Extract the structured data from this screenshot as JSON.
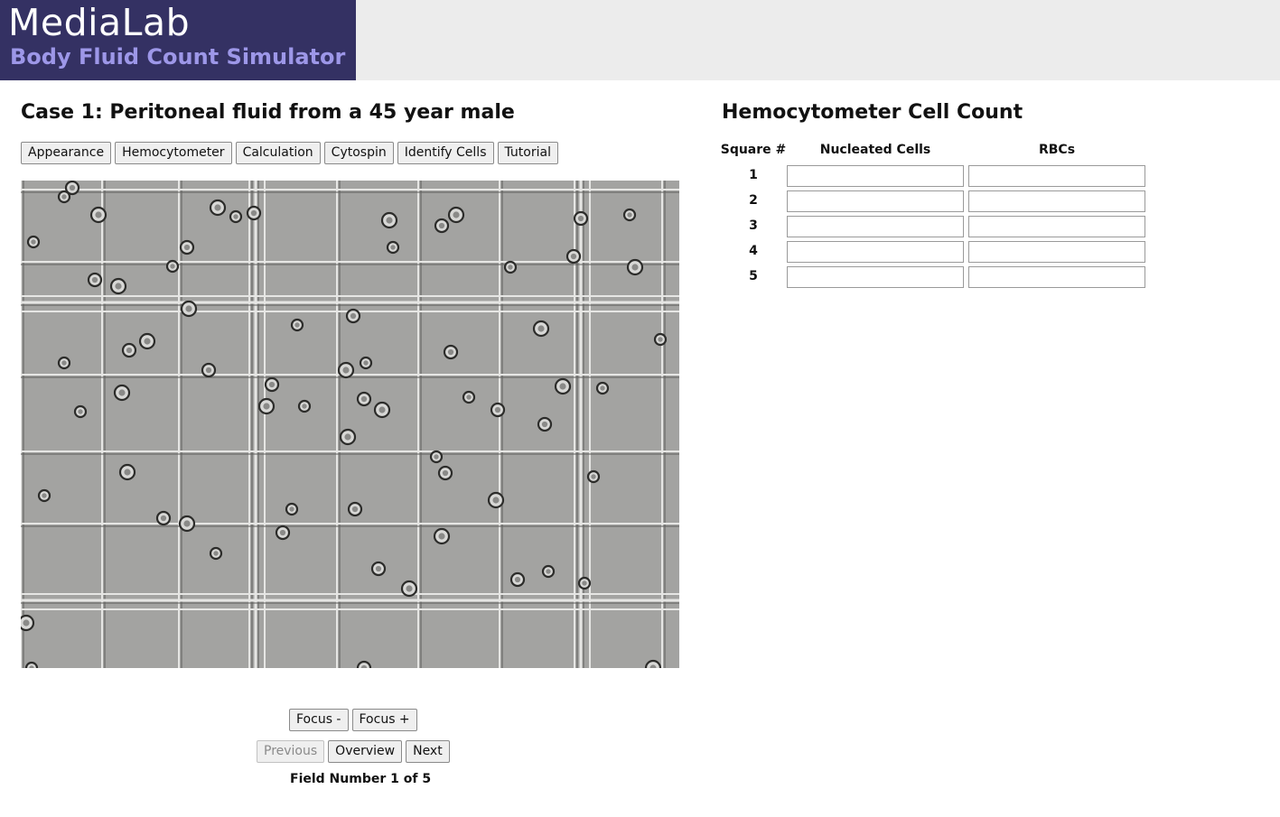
{
  "header": {
    "logo_main": "MediaLab",
    "logo_sub": "Body Fluid Count Simulator",
    "logo_color": "#343163",
    "sub_color": "#9d97e8"
  },
  "case": {
    "title": "Case 1: Peritoneal fluid from a 45 year male"
  },
  "nav": {
    "tabs": [
      "Appearance",
      "Hemocytometer",
      "Calculation",
      "Cytospin",
      "Identify Cells",
      "Tutorial"
    ]
  },
  "viewer": {
    "focus_minus": "Focus -",
    "focus_plus": "Focus +",
    "previous": "Previous",
    "previous_disabled": true,
    "overview": "Overview",
    "next": "Next",
    "field_label": "Field Number 1 of 5"
  },
  "count": {
    "title": "Hemocytometer Cell Count",
    "headers": {
      "square": "Square #",
      "nucleated": "Nucleated Cells",
      "rbcs": "RBCs"
    },
    "rows": [
      {
        "square": "1",
        "nucleated": "",
        "rbcs": ""
      },
      {
        "square": "2",
        "nucleated": "",
        "rbcs": ""
      },
      {
        "square": "3",
        "nucleated": "",
        "rbcs": ""
      },
      {
        "square": "4",
        "nucleated": "",
        "rbcs": ""
      },
      {
        "square": "5",
        "nucleated": "",
        "rbcs": ""
      }
    ]
  }
}
